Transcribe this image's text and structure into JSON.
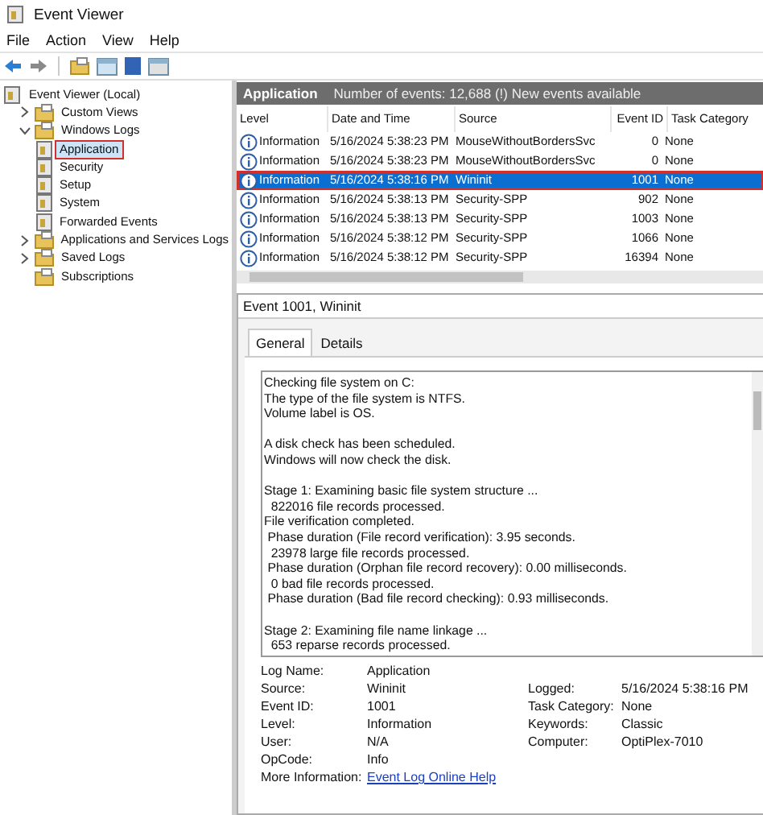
{
  "window": {
    "title": "Event Viewer"
  },
  "menu": [
    "File",
    "Action",
    "View",
    "Help"
  ],
  "tree": [
    {
      "label": "Event Viewer (Local)",
      "selected": false,
      "children": [
        {
          "label": "Custom Views",
          "expanded": false,
          "selected": false
        },
        {
          "label": "Windows Logs",
          "expanded": true,
          "selected": false,
          "children": [
            {
              "label": "Application",
              "selected": true
            },
            {
              "label": "Security",
              "selected": false
            },
            {
              "label": "Setup",
              "selected": false
            },
            {
              "label": "System",
              "selected": false
            },
            {
              "label": "Forwarded Events",
              "selected": false
            }
          ]
        },
        {
          "label": "Applications and Services Logs",
          "expanded": false,
          "selected": false
        },
        {
          "label": "Saved Logs",
          "expanded": false,
          "selected": false
        },
        {
          "label": "Subscriptions",
          "selected": false
        }
      ]
    }
  ],
  "log_header": {
    "title": "Application",
    "summary": "Number of events: 12,688 (!) New events available"
  },
  "table": {
    "columns": [
      "Level",
      "Date and Time",
      "Source",
      "Event ID",
      "Task Category"
    ],
    "rows": [
      {
        "level": "Information",
        "date_time": "5/16/2024 5:38:23 PM",
        "source": "MouseWithoutBordersSvc",
        "event_id": "0",
        "task_category": "None",
        "selected": false
      },
      {
        "level": "Information",
        "date_time": "5/16/2024 5:38:23 PM",
        "source": "MouseWithoutBordersSvc",
        "event_id": "0",
        "task_category": "None",
        "selected": false
      },
      {
        "level": "Information",
        "date_time": "5/16/2024 5:38:16 PM",
        "source": "Wininit",
        "event_id": "1001",
        "task_category": "None",
        "selected": true
      },
      {
        "level": "Information",
        "date_time": "5/16/2024 5:38:13 PM",
        "source": "Security-SPP",
        "event_id": "902",
        "task_category": "None",
        "selected": false
      },
      {
        "level": "Information",
        "date_time": "5/16/2024 5:38:13 PM",
        "source": "Security-SPP",
        "event_id": "1003",
        "task_category": "None",
        "selected": false
      },
      {
        "level": "Information",
        "date_time": "5/16/2024 5:38:12 PM",
        "source": "Security-SPP",
        "event_id": "1066",
        "task_category": "None",
        "selected": false
      },
      {
        "level": "Information",
        "date_time": "5/16/2024 5:38:12 PM",
        "source": "Security-SPP",
        "event_id": "16394",
        "task_category": "None",
        "selected": false
      }
    ]
  },
  "detail": {
    "title": "Event 1001, Wininit",
    "tabs": [
      {
        "label": "General",
        "selected": true
      },
      {
        "label": "Details",
        "selected": false
      }
    ],
    "message": "Checking file system on C:\nThe type of the file system is NTFS.\nVolume label is OS.\n\nA disk check has been scheduled.\nWindows will now check the disk.\n\nStage 1: Examining basic file system structure ...\n  822016 file records processed.\nFile verification completed.\n Phase duration (File record verification): 3.95 seconds.\n  23978 large file records processed.\n Phase duration (Orphan file record recovery): 0.00 milliseconds.\n  0 bad file records processed.\n Phase duration (Bad file record checking): 0.93 milliseconds.\n\nStage 2: Examining file name linkage ...\n  653 reparse records processed.",
    "properties": [
      [
        {
          "label": "Log Name:",
          "value": "Application"
        }
      ],
      [
        {
          "label": "Source:",
          "value": "Wininit"
        },
        {
          "label": "Logged:",
          "value": "5/16/2024 5:38:16 PM"
        }
      ],
      [
        {
          "label": "Event ID:",
          "value": "1001"
        },
        {
          "label": "Task Category:",
          "value": "None"
        }
      ],
      [
        {
          "label": "Level:",
          "value": "Information"
        },
        {
          "label": "Keywords:",
          "value": "Classic"
        }
      ],
      [
        {
          "label": "User:",
          "value": "N/A"
        },
        {
          "label": "Computer:",
          "value": "OptiPlex-7010"
        }
      ],
      [
        {
          "label": "OpCode:",
          "value": "Info"
        }
      ],
      [
        {
          "label": "More Information:",
          "link": "Event Log Online Help"
        }
      ]
    ]
  }
}
